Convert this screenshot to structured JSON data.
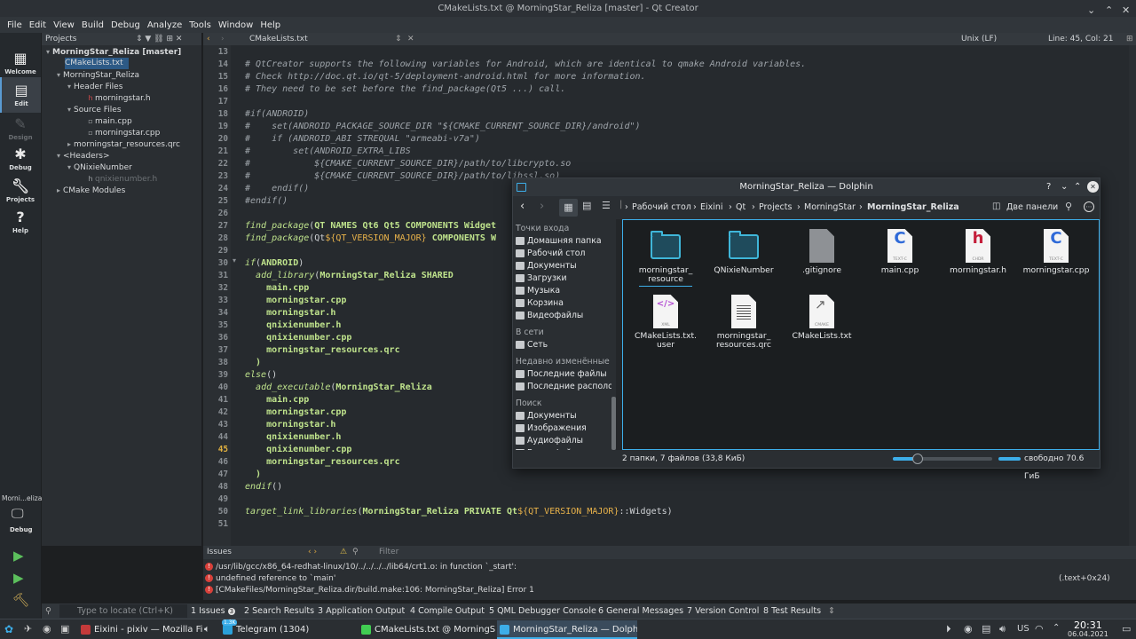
{
  "window": {
    "title": "CMakeLists.txt @ MorningStar_Reliza [master] - Qt Creator"
  },
  "menu": [
    "File",
    "Edit",
    "View",
    "Build",
    "Debug",
    "Analyze",
    "Tools",
    "Window",
    "Help"
  ],
  "modes": [
    {
      "label": "Welcome",
      "icon": "grid-icon"
    },
    {
      "label": "Edit",
      "icon": "edit-icon"
    },
    {
      "label": "Design",
      "icon": "pen-icon"
    },
    {
      "label": "Debug",
      "icon": "bug-icon"
    },
    {
      "label": "Projects",
      "icon": "wrench-icon"
    },
    {
      "label": "Help",
      "icon": "help-icon"
    }
  ],
  "kit": {
    "name": "Morni...eliza",
    "label": "Debug"
  },
  "projects_panel": {
    "title": "Projects",
    "tree": [
      "MorningStar_Reliza [master]",
      "CMakeLists.txt",
      "MorningStar_Reliza",
      "Header Files",
      "morningstar.h",
      "Source Files",
      "main.cpp",
      "morningstar.cpp",
      "morningstar_resources.qrc",
      "<Headers>",
      "QNixieNumber",
      "qnixienumber.h",
      "CMake Modules"
    ]
  },
  "editor": {
    "tab": "CMakeLists.txt",
    "line_ending": "Unix (LF)",
    "position": "Line: 45, Col: 21",
    "current_line": 45,
    "lines": [
      {
        "n": 13,
        "t": ""
      },
      {
        "n": 14,
        "t": "# QtCreator supports the following variables for Android, which are identical to qmake Android variables."
      },
      {
        "n": 15,
        "t": "# Check http://doc.qt.io/qt-5/deployment-android.html for more information."
      },
      {
        "n": 16,
        "t": "# They need to be set before the find_package(Qt5 ...) call."
      },
      {
        "n": 17,
        "t": ""
      },
      {
        "n": 18,
        "t": "#if(ANDROID)"
      },
      {
        "n": 19,
        "t": "#    set(ANDROID_PACKAGE_SOURCE_DIR \"${CMAKE_CURRENT_SOURCE_DIR}/android\")"
      },
      {
        "n": 20,
        "t": "#    if (ANDROID_ABI STREQUAL \"armeabi-v7a\")"
      },
      {
        "n": 21,
        "t": "#        set(ANDROID_EXTRA_LIBS"
      },
      {
        "n": 22,
        "t": "#            ${CMAKE_CURRENT_SOURCE_DIR}/path/to/libcrypto.so"
      },
      {
        "n": 23,
        "t": "#            ${CMAKE_CURRENT_SOURCE_DIR}/path/to/libssl.so)"
      },
      {
        "n": 24,
        "t": "#    endif()"
      },
      {
        "n": 25,
        "t": "#endif()"
      },
      {
        "n": 26,
        "t": ""
      },
      {
        "n": 27,
        "t": "find_package(QT NAMES Qt6 Qt5 COMPONENTS Widget"
      },
      {
        "n": 28,
        "t": "find_package(Qt${QT_VERSION_MAJOR} COMPONENTS W"
      },
      {
        "n": 29,
        "t": ""
      },
      {
        "n": 30,
        "t": "if(ANDROID)"
      },
      {
        "n": 31,
        "t": "  add_library(MorningStar_Reliza SHARED"
      },
      {
        "n": 32,
        "t": "    main.cpp"
      },
      {
        "n": 33,
        "t": "    morningstar.cpp"
      },
      {
        "n": 34,
        "t": "    morningstar.h"
      },
      {
        "n": 35,
        "t": "    qnixienumber.h"
      },
      {
        "n": 36,
        "t": "    qnixienumber.cpp"
      },
      {
        "n": 37,
        "t": "    morningstar_resources.qrc"
      },
      {
        "n": 38,
        "t": "  )"
      },
      {
        "n": 39,
        "t": "else()"
      },
      {
        "n": 40,
        "t": "  add_executable(MorningStar_Reliza"
      },
      {
        "n": 41,
        "t": "    main.cpp"
      },
      {
        "n": 42,
        "t": "    morningstar.cpp"
      },
      {
        "n": 43,
        "t": "    morningstar.h"
      },
      {
        "n": 44,
        "t": "    qnixienumber.h"
      },
      {
        "n": 45,
        "t": "    qnixienumber.cpp"
      },
      {
        "n": 46,
        "t": "    morningstar_resources.qrc"
      },
      {
        "n": 47,
        "t": "  )"
      },
      {
        "n": 48,
        "t": "endif()"
      },
      {
        "n": 49,
        "t": ""
      },
      {
        "n": 50,
        "t": "target_link_libraries(MorningStar_Reliza PRIVATE Qt${QT_VERSION_MAJOR}::Widgets)"
      },
      {
        "n": 51,
        "t": ""
      }
    ]
  },
  "issues": {
    "title": "Issues",
    "filter_placeholder": "Filter",
    "items": [
      {
        "text": "/usr/lib/gcc/x86_64-redhat-linux/10/../../../../lib64/crt1.o: in function `_start':",
        "loc": ""
      },
      {
        "text": "undefined reference to `main'",
        "loc": "(.text+0x24)"
      },
      {
        "text": "[CMakeFiles/MorningStar_Reliza.dir/build.make:106: MorningStar_Reliza] Error 1",
        "loc": ""
      }
    ]
  },
  "outbar": {
    "locator_placeholder": "Type to locate (Ctrl+K)",
    "tabs": [
      "1 Issues",
      "2 Search Results",
      "3 Application Output",
      "4 Compile Output",
      "5 QML Debugger Console",
      "6 General Messages",
      "7 Version Control",
      "8 Test Results"
    ],
    "issues_badge": "3"
  },
  "dolphin": {
    "title": "MorningStar_Reliza — Dolphin",
    "breadcrumb": [
      "Рабочий стол",
      "Eixini",
      "Qt",
      "Projects",
      "MorningStar",
      "MorningStar_Reliza"
    ],
    "split_label": "Две панели",
    "places": [
      {
        "type": "hdr",
        "label": "Точки входа"
      },
      {
        "type": "item",
        "label": "Домашняя папка"
      },
      {
        "type": "item",
        "label": "Рабочий стол"
      },
      {
        "type": "item",
        "label": "Документы"
      },
      {
        "type": "item",
        "label": "Загрузки"
      },
      {
        "type": "item",
        "label": "Музыка"
      },
      {
        "type": "item",
        "label": "Корзина"
      },
      {
        "type": "item",
        "label": "Видеофайлы"
      },
      {
        "type": "hdr",
        "label": "В сети"
      },
      {
        "type": "item",
        "label": "Сеть"
      },
      {
        "type": "hdr",
        "label": "Недавно изменённые"
      },
      {
        "type": "item",
        "label": "Последние файлы"
      },
      {
        "type": "item",
        "label": "Последние располо"
      },
      {
        "type": "hdr",
        "label": "Поиск"
      },
      {
        "type": "item",
        "label": "Документы"
      },
      {
        "type": "item",
        "label": "Изображения"
      },
      {
        "type": "item",
        "label": "Аудиофайлы"
      },
      {
        "type": "item",
        "label": "Видеофайлы"
      }
    ],
    "files": [
      {
        "name": "morningstar_\nresource",
        "kind": "folder"
      },
      {
        "name": "QNixieNumber",
        "kind": "folder"
      },
      {
        "name": ".gitignore",
        "kind": "blank"
      },
      {
        "name": "main.cpp",
        "kind": "cpp",
        "badge": "C",
        "sub": "TEXT-C"
      },
      {
        "name": "morningstar.h",
        "kind": "h",
        "badge": "h",
        "sub": "CHDR"
      },
      {
        "name": "morningstar.cpp",
        "kind": "cpp",
        "badge": "C",
        "sub": "TEXT-C"
      },
      {
        "name": "CMakeLists.txt.\nuser",
        "kind": "xml",
        "badge": "</>",
        "sub": "XML"
      },
      {
        "name": "morningstar_\nresources.qrc",
        "kind": "text"
      },
      {
        "name": "CMakeLists.txt",
        "kind": "cmake",
        "sub": "CMAKE"
      }
    ],
    "status": "2 папки, 7 файлов (33,8 КиБ)",
    "free_space": "свободно 70.6 ГиБ",
    "zoom_level": 0.25
  },
  "taskbar": {
    "tasks": [
      {
        "label": "Eixini - pixiv — Mozilla Fi...",
        "active": false
      },
      {
        "label": "Telegram (1304)",
        "active": false
      },
      {
        "label": "CMakeLists.txt @ MorningSt...",
        "active": false
      },
      {
        "label": "MorningStar_Reliza — Dolphin",
        "active": true
      }
    ],
    "kb_layout": "US",
    "time": "20:31",
    "date": "06.04.2021",
    "badge": "1.3K"
  },
  "colors": {
    "accent": "#3daee9",
    "error": "#d9413b",
    "selection": "#2d5a86"
  }
}
